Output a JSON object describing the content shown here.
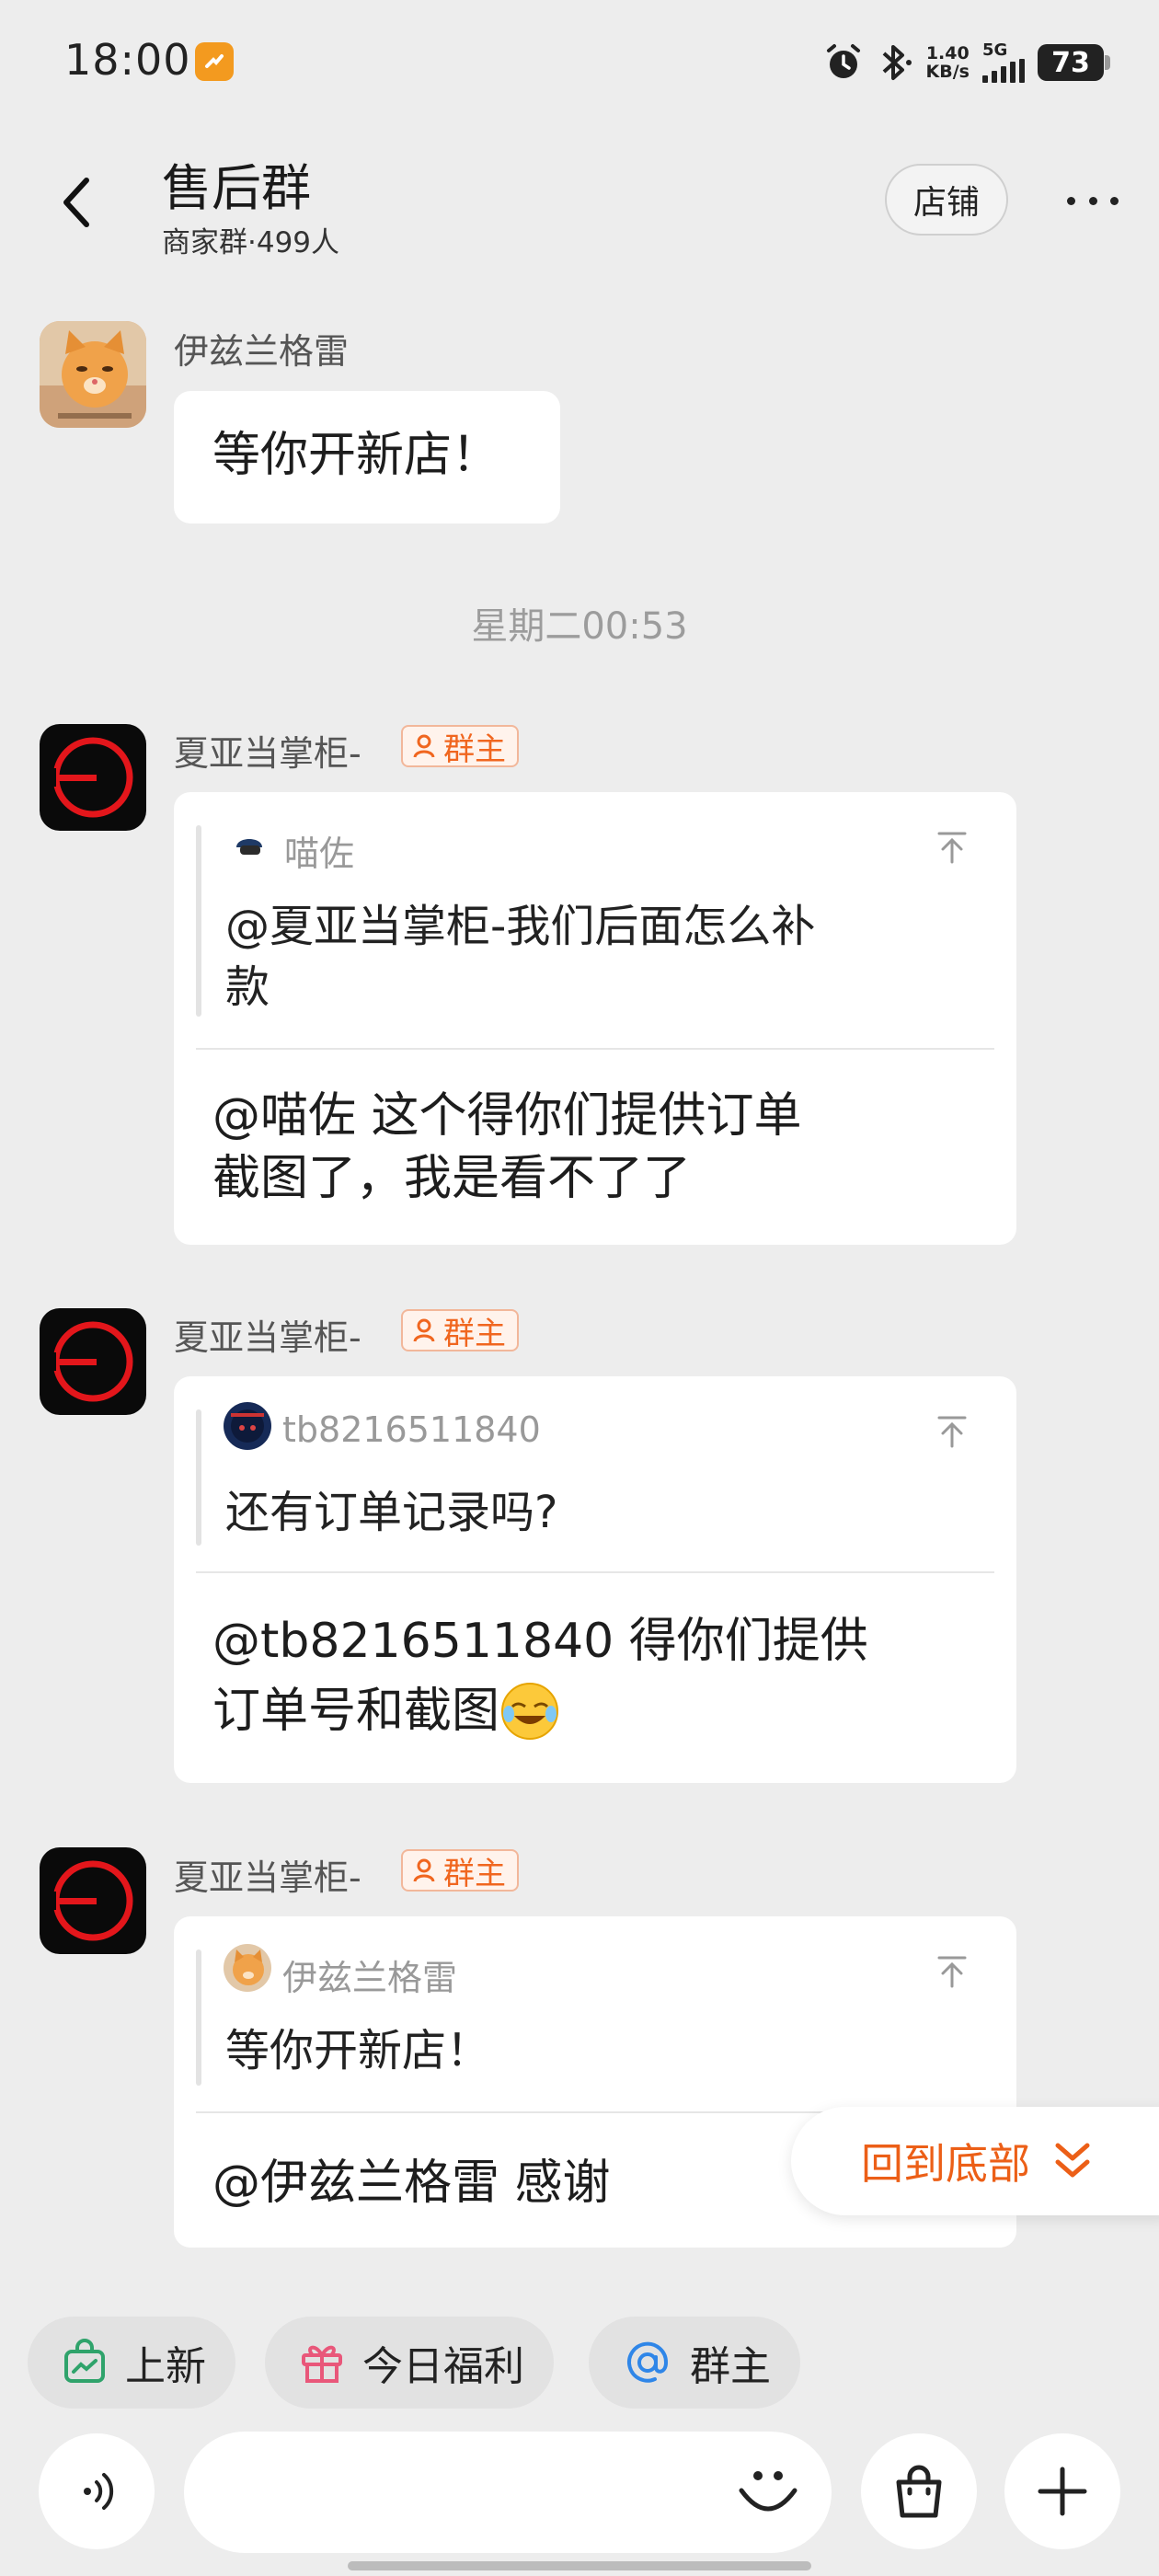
{
  "status_bar": {
    "time": "18:00",
    "net_speed_value": "1.40",
    "net_speed_unit": "KB/s",
    "network": "5G",
    "battery": "73"
  },
  "header": {
    "title": "售后群",
    "subtitle": "商家群·499人",
    "shop_label": "店铺"
  },
  "messages": {
    "m1": {
      "sender": "伊兹兰格雷",
      "text": "等你开新店！"
    },
    "timestamp": "星期二00:53",
    "m2": {
      "sender": "夏亚当掌柜-",
      "badge": "群主",
      "quote_name": "喵佐",
      "quote_line1": "@夏亚当掌柜-我们后面怎么补",
      "quote_line2": "款",
      "reply_line1": "@喵佐 这个得你们提供订单",
      "reply_line2": "截图了，我是看不了了"
    },
    "m3": {
      "sender": "夏亚当掌柜-",
      "badge": "群主",
      "quote_name": "tb8216511840",
      "quote_line1": "还有订单记录吗?",
      "reply_line1": "@tb8216511840 得你们提供",
      "reply_line2": "订单号和截图"
    },
    "m4": {
      "sender": "夏亚当掌柜-",
      "badge": "群主",
      "quote_name": "伊兹兰格雷",
      "quote_line1": "等你开新店！",
      "reply_line1": "@伊兹兰格雷 感谢"
    }
  },
  "back_to_bottom": "回到底部",
  "quick_actions": [
    {
      "label": "上新",
      "icon": "shopping-bag-icon"
    },
    {
      "label": "今日福利",
      "icon": "gift-icon"
    },
    {
      "label": "群主",
      "icon": "at-sign-icon"
    }
  ],
  "colors": {
    "accent": "#ec5f17",
    "background": "#ededed"
  }
}
